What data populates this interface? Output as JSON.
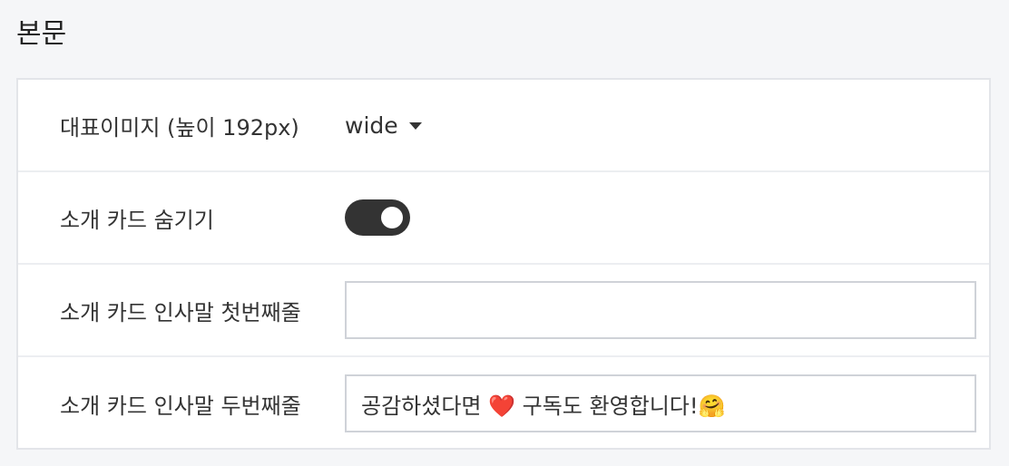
{
  "section": {
    "title": "본문"
  },
  "settings": [
    {
      "label": "대표이미지 (높이 192px)",
      "type": "select",
      "value": "wide"
    },
    {
      "label": "소개 카드 숨기기",
      "type": "toggle",
      "value": true
    },
    {
      "label": "소개 카드 인사말 첫번째줄",
      "type": "text",
      "value": ""
    },
    {
      "label": "소개 카드 인사말 두번째줄",
      "type": "text",
      "value": "공감하셨다면 ❤️ 구독도 환영합니다!🤗"
    }
  ],
  "icons": {
    "select_caret": "caret-down-icon"
  },
  "colors": {
    "toggle_on": "#333333",
    "field_border": "#cfd2d8",
    "panel_border": "#e3e5e9"
  }
}
